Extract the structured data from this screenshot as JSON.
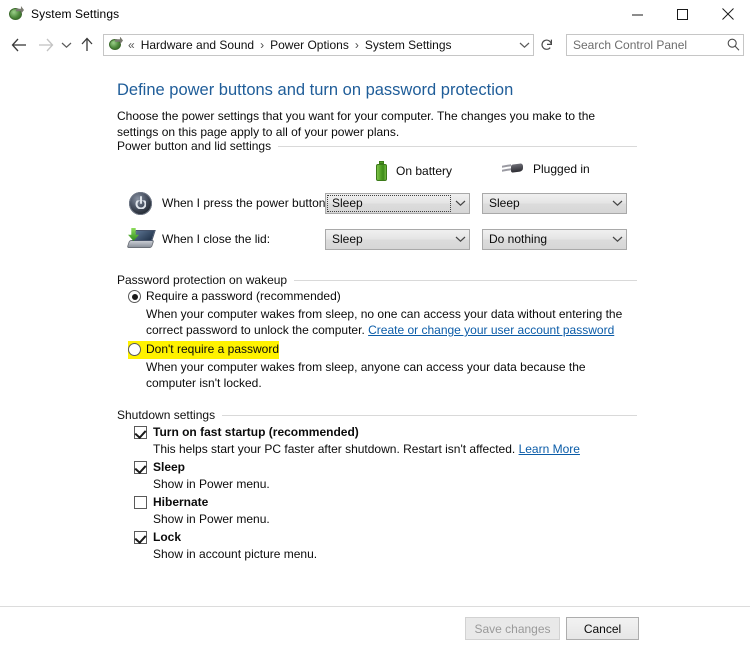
{
  "window": {
    "title": "System Settings",
    "icon": "control-panel-icon",
    "controls": {
      "minimize": "minimize-icon",
      "maximize": "maximize-icon",
      "close": "close-icon"
    }
  },
  "nav": {
    "back": "back-arrow-icon",
    "forward": "forward-arrow-icon",
    "recent": "chevron-down-icon",
    "up": "up-arrow-icon",
    "breadcrumb_lead": "«",
    "breadcrumb": [
      {
        "label": "Hardware and Sound"
      },
      {
        "label": "Power Options"
      },
      {
        "label": "System Settings"
      }
    ],
    "separator": "›",
    "dropdown": "chevron-down-icon",
    "refresh": "refresh-icon"
  },
  "search": {
    "placeholder": "Search Control Panel",
    "value": "",
    "icon": "search-icon"
  },
  "page": {
    "title": "Define power buttons and turn on password protection",
    "description": "Choose the power settings that you want for your computer. The changes you make to the settings on this page apply to all of your power plans."
  },
  "power_group": {
    "legend": "Power button and lid settings",
    "columns": [
      {
        "label": "On battery",
        "icon": "battery-icon"
      },
      {
        "label": "Plugged in",
        "icon": "power-plug-icon"
      }
    ],
    "rows": [
      {
        "icon": "power-button-icon",
        "label": "When I press the power button:",
        "battery_value": "Sleep",
        "plugged_value": "Sleep",
        "battery_focused": true
      },
      {
        "icon": "laptop-lid-icon",
        "label": "When I close the lid:",
        "battery_value": "Sleep",
        "plugged_value": "Do nothing",
        "battery_focused": false
      }
    ]
  },
  "password_group": {
    "legend": "Password protection on wakeup",
    "options": [
      {
        "label": "Require a password (recommended)",
        "selected": true,
        "description_before": "When your computer wakes from sleep, no one can access your data without entering the correct password to unlock the computer. ",
        "link": "Create or change your user account password",
        "description_after": ""
      },
      {
        "label": "Don't require a password",
        "selected": false,
        "highlighted": true,
        "description_before": "When your computer wakes from sleep, anyone can access your data because the computer isn't locked.",
        "link": "",
        "description_after": ""
      }
    ],
    "highlight_color": "#fff200"
  },
  "shutdown_group": {
    "legend": "Shutdown settings",
    "items": [
      {
        "label": "Turn on fast startup (recommended)",
        "checked": true,
        "description": "This helps start your PC faster after shutdown. Restart isn't affected. ",
        "link": "Learn More"
      },
      {
        "label": "Sleep",
        "checked": true,
        "description": "Show in Power menu.",
        "link": ""
      },
      {
        "label": "Hibernate",
        "checked": false,
        "description": "Show in Power menu.",
        "link": ""
      },
      {
        "label": "Lock",
        "checked": true,
        "description": "Show in account picture menu.",
        "link": ""
      }
    ]
  },
  "footer": {
    "save_label": "Save changes",
    "save_enabled": false,
    "cancel_label": "Cancel"
  },
  "colors": {
    "title_blue": "#1f5d99",
    "link_blue": "#0b5ca8",
    "highlight_yellow": "#fff200",
    "battery_green": "#4e9e22"
  }
}
